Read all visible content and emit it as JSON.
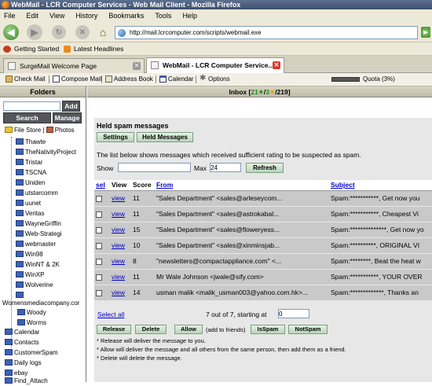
{
  "window": {
    "title": "WebMail - LCR Computer Services - Web Mail Client - Mozilla Firefox"
  },
  "menu": [
    "File",
    "Edit",
    "View",
    "History",
    "Bookmarks",
    "Tools",
    "Help"
  ],
  "url": "http://mail.lcrcomputer.com/scripts/webmail.exe",
  "bookmarks": [
    "Getting Started",
    "Latest Headlines"
  ],
  "tabs": [
    {
      "label": "SurgeMail Welcome Page"
    },
    {
      "label": "WebMail - LCR Computer Service..."
    }
  ],
  "toolbar": {
    "check_mail": "Check Mail",
    "compose": "Compose Mail",
    "address_book": "Address Book",
    "calendar": "Calendar",
    "options": "Options",
    "quota": "Quota (3%)"
  },
  "sidebar": {
    "header": "Folders",
    "add": "Add",
    "search": "Search",
    "manage": "Manage",
    "file_store": "File Store",
    "photos": "Photos",
    "folders": [
      "Thawte",
      "TheNativityProject",
      "Tristar",
      "TSCNA",
      "Uniden",
      "utstarcomm",
      "uunet",
      "Veritas",
      "WayneGriffin",
      "Web-Strategi",
      "webmaster",
      "Win98",
      "WinNT & 2K",
      "WinXP",
      "Wolverine"
    ],
    "root_folder": "Womensmediacompany.cor",
    "root_children": [
      "Woody",
      "Worms"
    ],
    "top_folders": [
      "Calendar",
      "Contacts",
      "CustomerSpam",
      "Daily logs",
      "ebay",
      "Find_Attach"
    ]
  },
  "inbox": {
    "label": "Inbox [",
    "unread": "21",
    "sep": "/",
    "new": "3",
    "total": "219]"
  },
  "held": {
    "title": "Held spam messages",
    "settings": "Settings",
    "held_messages": "Held Messages",
    "description": "The list below shows messages which received sufficient rating to be suspected as spam.",
    "show_label": "Show",
    "show_value": "",
    "max_label": "Max",
    "max_value": "24",
    "refresh": "Refresh",
    "columns": [
      "sel",
      "View",
      "Score",
      "From",
      "Subject"
    ],
    "rows": [
      {
        "view": "view",
        "score": "11",
        "from": "\"Sales Department\" <sales@arleseycom...",
        "subject": "Spam:***********, Get now you"
      },
      {
        "view": "view",
        "score": "11",
        "from": "\"Sales Department\" <sales@astrokabal...",
        "subject": "Spam:***********, Cheapest Vi"
      },
      {
        "view": "view",
        "score": "15",
        "from": "\"Sales Department\" <sales@floweryess...",
        "subject": "Spam:**************, Get now yo"
      },
      {
        "view": "view",
        "score": "10",
        "from": "\"Sales Department\" <sales@xinminsjab...",
        "subject": "Spam:**********, ORIGINAL VI"
      },
      {
        "view": "view",
        "score": "8",
        "from": "\"newsletters@compactappliance.com\" <...",
        "subject": "Spam:********, Beat the heat w"
      },
      {
        "view": "view",
        "score": "11",
        "from": "Mr Wale Johnson <jwale@sify.com>",
        "subject": "Spam:***********, YOUR OVER"
      },
      {
        "view": "view",
        "score": "14",
        "from": "usman malik <malik_usman003@yahoo.com.hk>...",
        "subject": "Spam:*************, Thanks an"
      }
    ],
    "select_all": "Select all",
    "count_text": "7 out of 7, starting at",
    "start_value": "0",
    "release": "Release",
    "delete": "Delete",
    "allow": "Allow",
    "allow_note": "(add to friends)",
    "isspam": "IsSpam",
    "notspam": "NotSpam",
    "notes": [
      "* Release will deliver the message to you.",
      "* Allow will deliver the message and all others from the same person, then add them as a friend.",
      "* Delete will delete the message."
    ]
  },
  "colors": {
    "accent": "#0000cc",
    "button_green": "#b9d6ba",
    "row_gray": "#c9c9c9"
  }
}
